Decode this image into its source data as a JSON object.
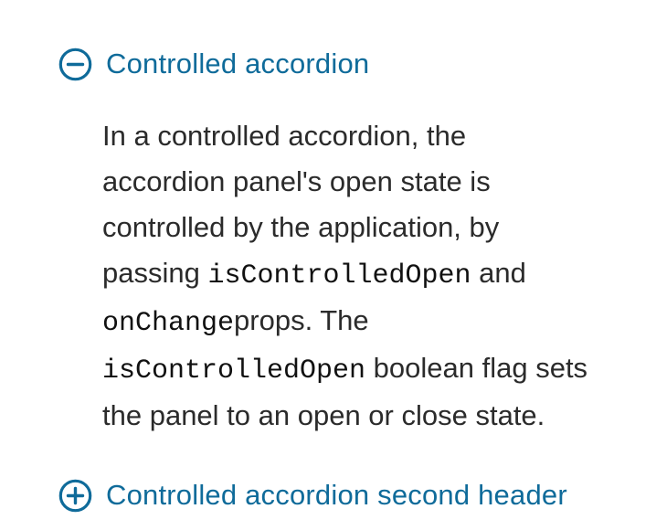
{
  "accordion": {
    "first_header": {
      "label": "Controlled accordion",
      "icon": "minus-circle-icon",
      "expanded": true
    },
    "panel": {
      "line1": "In a controlled accordion, the",
      "line2": "accordion panel's open state is",
      "line3": "controlled by the application, by",
      "line4_pre": "passing ",
      "line4_code": "isControlledOpen",
      "line4_post": " and",
      "line5_code": "onChange",
      "line5_post": "props. The",
      "line6_code": "isControlledOpen",
      "line6_post": " boolean flag sets",
      "line7": "the panel to an open or close state."
    },
    "second_header": {
      "label": "Controlled accordion second header",
      "icon": "plus-circle-icon",
      "expanded": false
    }
  },
  "colors": {
    "accent": "#0f6b9a",
    "body_text": "#2b2b2b"
  }
}
